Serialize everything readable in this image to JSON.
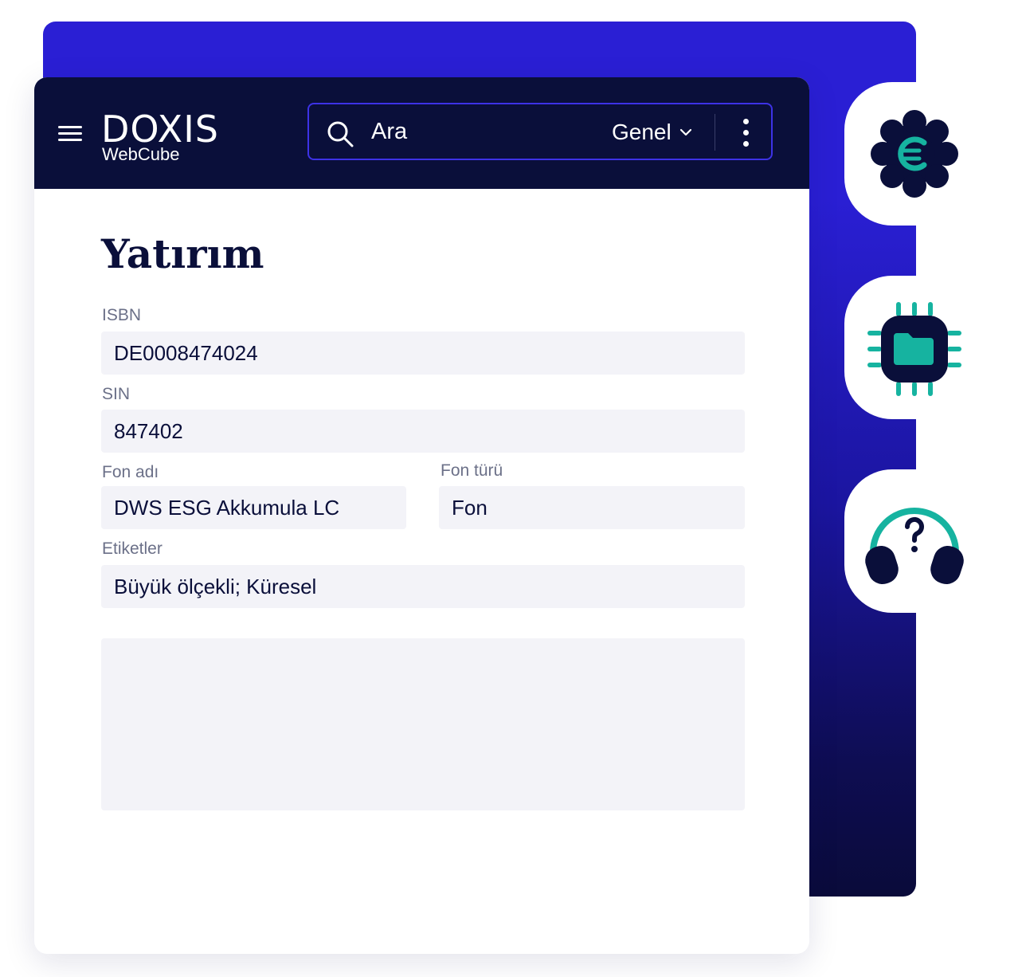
{
  "header": {
    "logo_text": "DOXIS",
    "logo_subtitle": "WebCube",
    "search_placeholder": "Ara",
    "scope_label": "Genel"
  },
  "page": {
    "title": "Yatırım"
  },
  "fields": {
    "isbn": {
      "label": "ISBN",
      "value": "DE0008474024"
    },
    "sin": {
      "label": "SIN",
      "value": "847402"
    },
    "fund_name": {
      "label": "Fon adı",
      "value": "DWS ESG Akkumula LC"
    },
    "fund_type": {
      "label": "Fon türü",
      "value": "Fon"
    },
    "tags": {
      "label": "Etiketler",
      "value": "Büyük ölçekli; Küresel"
    }
  },
  "side_icons": [
    "euro-gear-icon",
    "chip-folder-icon",
    "headset-question-icon"
  ],
  "colors": {
    "navy": "#0a0f3a",
    "brand_blue": "#2a1fd4",
    "accent_teal": "#16b3a0",
    "field_bg": "#f3f3f8"
  }
}
